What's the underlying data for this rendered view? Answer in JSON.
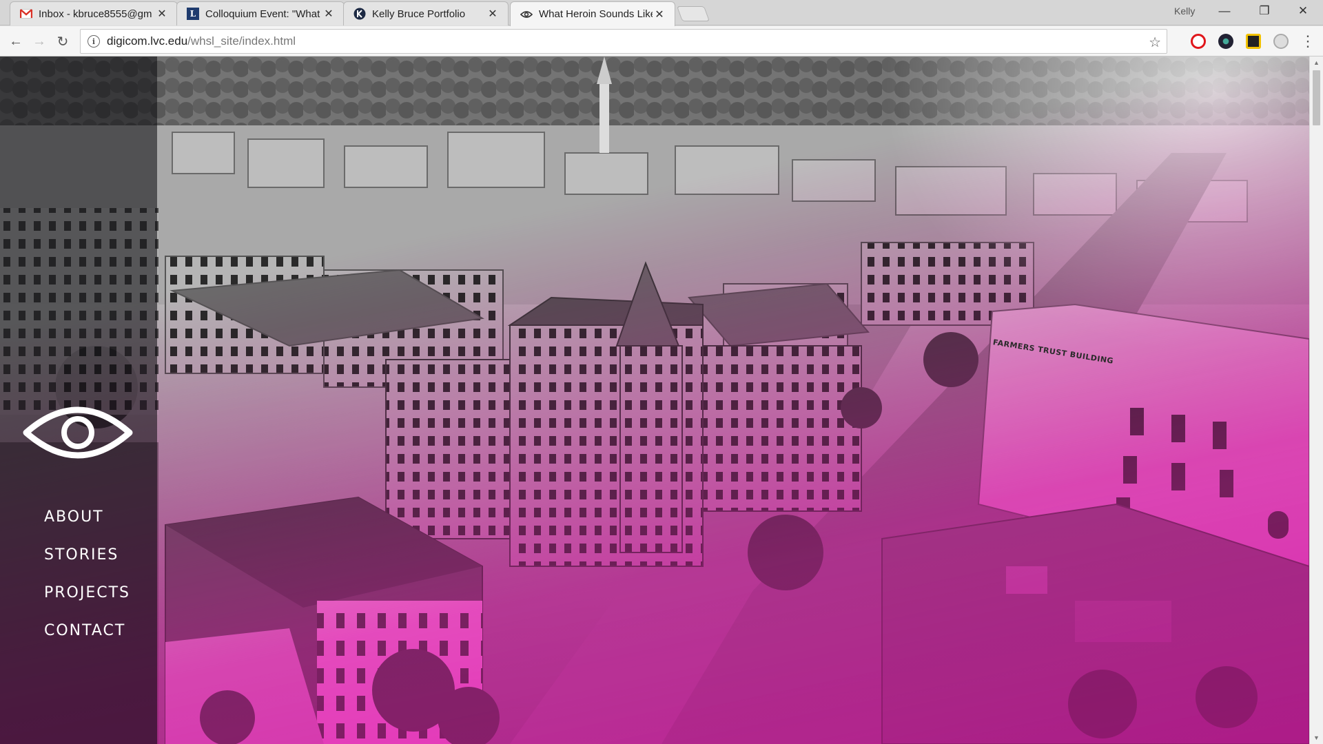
{
  "browser": {
    "tabs": [
      {
        "title": "Inbox - kbruce8555@gm",
        "favicon": "gmail-icon",
        "active": false
      },
      {
        "title": "Colloquium Event: \"What",
        "favicon": "l-icon",
        "active": false
      },
      {
        "title": "Kelly Bruce Portfolio",
        "favicon": "k-icon",
        "active": false
      },
      {
        "title": "What Heroin Sounds Like",
        "favicon": "eye-icon",
        "active": true
      }
    ],
    "profile_name": "Kelly",
    "window_controls": {
      "minimize": "—",
      "restore": "❐",
      "close": "✕"
    },
    "url_host": "digicom.lvc.edu",
    "url_path": "/whsl_site/index.html",
    "icons": {
      "back": "←",
      "forward": "→",
      "reload": "↻",
      "info": "i",
      "star": "☆",
      "menu": "⋮",
      "close_tab": "✕"
    }
  },
  "site": {
    "nav": [
      "ABOUT",
      "STORIES",
      "PROJECTS",
      "CONTACT"
    ],
    "building_sign": "FARMERS TRUST BUILDING",
    "accent_color": "#e6009b"
  }
}
